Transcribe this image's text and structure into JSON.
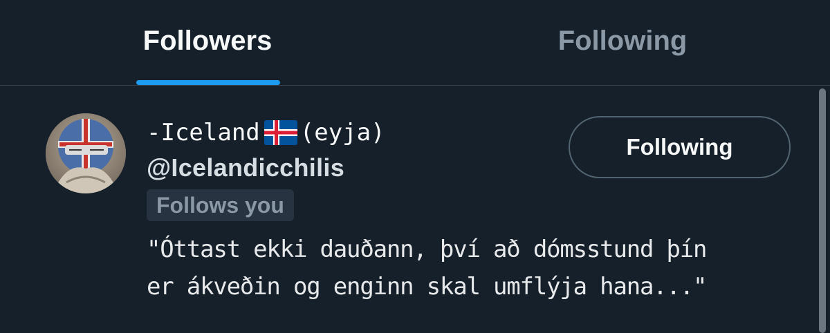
{
  "tabs": [
    {
      "label": "Followers",
      "active": true
    },
    {
      "label": "Following",
      "active": false
    }
  ],
  "user": {
    "display_name_prefix": "-Iceland",
    "flag": "iceland-flag",
    "display_name_suffix": "(eyja)",
    "handle": "@Icelandicchilis",
    "follows_badge": "Follows you",
    "button_label": "Following",
    "bio_lines": [
      "\"Óttast ekki dauðann, því að dómsstund þín",
      "er ákveðin og enginn skal umflýja hana...\""
    ]
  },
  "colors": {
    "background": "#15202b",
    "accent": "#1d9bf0",
    "divider": "#38444d",
    "muted_text": "#8b98a5"
  }
}
